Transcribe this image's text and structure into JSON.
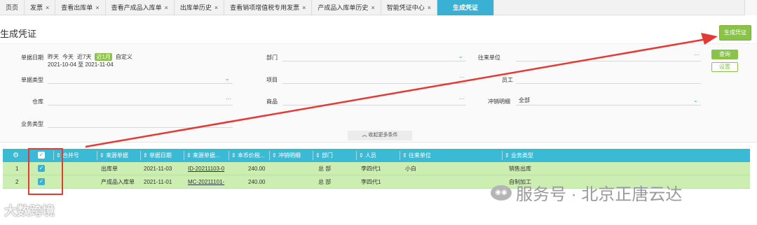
{
  "tabs": [
    {
      "label": "页页",
      "closable": false
    },
    {
      "label": "发票",
      "closable": true
    },
    {
      "label": "查看出库单",
      "closable": true
    },
    {
      "label": "查看产成品入库单",
      "closable": true
    },
    {
      "label": "出库单历史",
      "closable": true
    },
    {
      "label": "查看销项增值税专用发票",
      "closable": true
    },
    {
      "label": "产成品入库单历史",
      "closable": true
    },
    {
      "label": "智能凭证中心",
      "closable": true
    },
    {
      "label": "生成凭证",
      "closable": false,
      "active": true
    }
  ],
  "tab_close_glyph": "×",
  "page_title": "生成凭证",
  "generate_button": "生成凭证",
  "filters": {
    "doc_date_label": "单据日期",
    "date_options": [
      "昨天",
      "今天",
      "近7天",
      "近1月",
      "自定义"
    ],
    "date_selected": "近1月",
    "date_range": "2021-10-04 至 2021-11-04",
    "department_label": "部门",
    "partner_label": "往来单位",
    "doc_type_label": "单据类型",
    "project_label": "项目",
    "employee_label": "员工",
    "warehouse_label": "仓库",
    "goods_label": "商品",
    "offset_label": "冲销明细",
    "offset_value": "全部",
    "business_type_label": "业务类型",
    "query_button": "查询",
    "settings_button": "设置",
    "collapse_label": "收起更多条件",
    "dots": "···",
    "chevron": "⌄"
  },
  "table": {
    "columns": [
      "合并号",
      "来源单据",
      "单据日期",
      "来源单据...",
      "本币价税...",
      "冲销明细",
      "部门",
      "人员",
      "往来单位",
      "业务类型"
    ],
    "sort_glyph": "⇕",
    "rows": [
      {
        "index": "1",
        "merge": "",
        "source": "出库单",
        "date": "2021-11-03",
        "code": "ID-20211103-0",
        "amount": "240.00",
        "offset": "",
        "dept": "总 部",
        "person": "李四代1",
        "partner": "小白",
        "biz_type": "销售出库"
      },
      {
        "index": "2",
        "merge": "",
        "source": "产成品入库单",
        "date": "2021-11-01",
        "code": "MC-20211101-",
        "amount": "240.00",
        "offset": "",
        "dept": "总 部",
        "person": "李四代1",
        "partner": "",
        "biz_type": "自制加工"
      }
    ]
  },
  "watermarks": {
    "left": "大数跨境",
    "right": "服务号 · 北京正唐云达"
  },
  "colors": {
    "accent": "#3ab0d4",
    "primary_green": "#8bc34a",
    "row_selected": "#cdeeb3",
    "annotation_red": "#e53935"
  }
}
